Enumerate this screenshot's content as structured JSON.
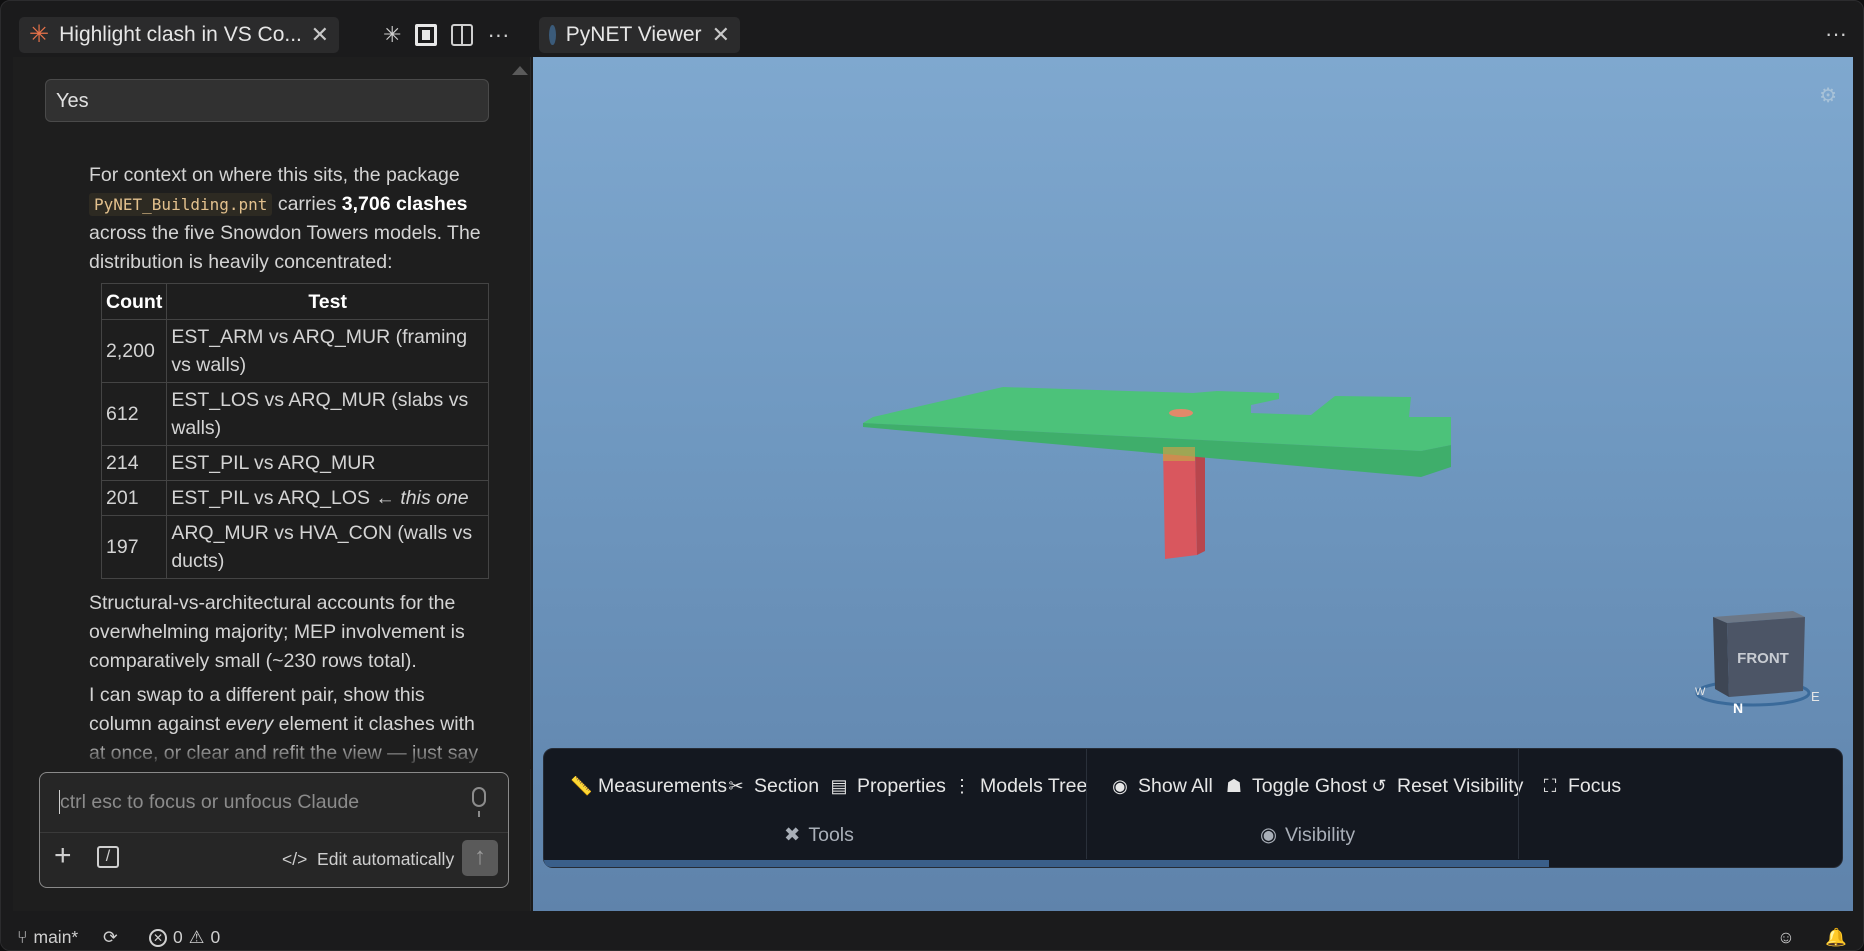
{
  "left_tab": {
    "title": "Highlight clash in VS Co..."
  },
  "prompt": {
    "text": "Yes"
  },
  "message": {
    "intro_1": "For context on where this sits, the package",
    "filename": "PyNET_Building.pnt",
    "intro_2": "carries",
    "count_bold": "3,706 clashes",
    "intro_3": "across the five Snowdon Towers models. The distribution is heavily concentrated:"
  },
  "table": {
    "headers": [
      "Count",
      "Test"
    ],
    "rows": [
      {
        "count": "2,200",
        "test": "EST_ARM vs ARQ_MUR (framing vs walls)",
        "note": ""
      },
      {
        "count": "612",
        "test": "EST_LOS vs ARQ_MUR (slabs vs walls)",
        "note": ""
      },
      {
        "count": "214",
        "test": "EST_PIL vs ARQ_MUR",
        "note": ""
      },
      {
        "count": "201",
        "test": "EST_PIL vs ARQ_LOS ← ",
        "note": "this one"
      },
      {
        "count": "197",
        "test": "ARQ_MUR vs HVA_CON (walls vs ducts)",
        "note": ""
      }
    ]
  },
  "message2": "Structural-vs-architectural accounts for the overwhelming majority; MEP involvement is comparatively small (~230 rows total).",
  "message3": {
    "part1": "I can swap to a different pair, show this column against ",
    "emph": "every",
    "part2": " element it clashes with at once, or clear and refit the view — just say which."
  },
  "input": {
    "placeholder": "ctrl esc to focus or unfocus Claude",
    "edit_label": "Edit automatically",
    "edit_icon": "</>"
  },
  "right_tab": {
    "title": "PyNET Viewer"
  },
  "viewcube": {
    "face": "FRONT",
    "w": "W",
    "n": "N",
    "e": "E"
  },
  "toolbar": {
    "tools": [
      "Measurements",
      "Section",
      "Properties",
      "Models Tree"
    ],
    "tools_group": "Tools",
    "visibility": [
      "Show All",
      "Toggle Ghost",
      "Reset Visibility"
    ],
    "visibility_group": "Visibility",
    "focus": "Focus"
  },
  "status": {
    "branch": "main*",
    "errors": "0",
    "warnings": "0"
  },
  "colors": {
    "accent": "#e8734a",
    "slab": "#4cc27a",
    "column": "#d9575e",
    "viewer_bg": "#7fa8cf"
  }
}
